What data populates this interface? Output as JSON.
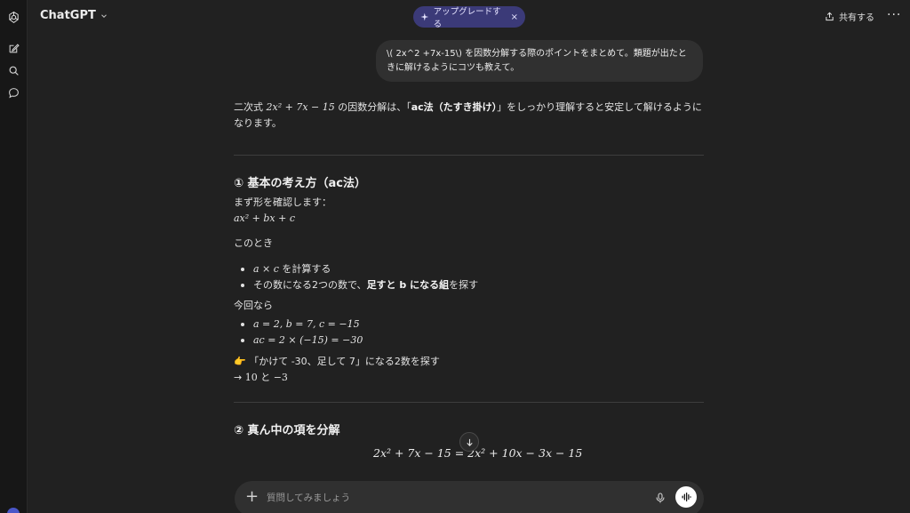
{
  "app": {
    "model_label": "ChatGPT"
  },
  "header": {
    "upgrade_label": "アップグレードする",
    "upgrade_close": "×",
    "share_label": "共有する",
    "more": "···"
  },
  "user_message": "\\( 2x^2 +7x-15\\) を因数分解する際のポイントをまとめて。類題が出たときに解けるようにコツも教えて。",
  "answer": {
    "intro_pre": "二次式 ",
    "intro_expr": "2x² + 7x − 15",
    "intro_mid": " の因数分解は、「",
    "intro_bold": "ac法（たすき掛け）",
    "intro_post": "」をしっかり理解すると安定して解けるようになります。",
    "section1_title": "① 基本の考え方（ac法）",
    "s1_line1": "まず形を確認します：",
    "s1_form": "ax² + bx + c",
    "s1_then": "このとき",
    "s1_b1_expr": "a × c",
    "s1_b1_text": " を計算する",
    "s1_b2_pre": "その数になる2つの数で、",
    "s1_b2_bold": "足すと b になる組",
    "s1_b2_post": "を探す",
    "s1_case": "今回なら",
    "s1_c1": "a = 2, b = 7, c = −15",
    "s1_c2": "ac = 2 × (−15) = −30",
    "s1_hint_emoji": "👉",
    "s1_hint": "「かけて -30、足して 7」になる2数を探す",
    "s1_result_arrow": "→",
    "s1_result_a": "10",
    "s1_result_and": " と ",
    "s1_result_b": "−3",
    "section2_title": "② 真ん中の項を分解",
    "s2_eq": "2x² + 7x − 15 = 2x² + 10x − 3x − 15"
  },
  "composer": {
    "placeholder": "質問してみましょう"
  },
  "colors": {
    "background": "#212121",
    "sidebar": "#171717",
    "bubble": "#303030",
    "upgrade_pill": "#3b3a78"
  },
  "icons": [
    "openai-logo-icon",
    "new-chat-icon",
    "search-icon",
    "chat-bubble-icon",
    "chevron-down-icon",
    "sparkle-icon",
    "share-icon",
    "more-icon",
    "arrow-down-icon",
    "plus-icon",
    "mic-icon",
    "voice-mode-icon"
  ]
}
